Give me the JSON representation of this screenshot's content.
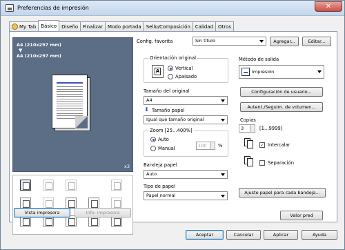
{
  "window": {
    "title": "Preferencias de impresión",
    "close_glyph": "✕"
  },
  "tabs": [
    {
      "label": "My Tab",
      "icon": "user-icon"
    },
    {
      "label": "Básico",
      "active": true
    },
    {
      "label": "Diseño"
    },
    {
      "label": "Finalizar"
    },
    {
      "label": "Modo portada"
    },
    {
      "label": "Sello/Composición"
    },
    {
      "label": "Calidad"
    },
    {
      "label": "Otros"
    }
  ],
  "preview": {
    "paper_top": "A4 (210x297 mm)",
    "arrow": "▼",
    "paper_bottom": "A4 (210x297 mm)",
    "copies_badge": "x3"
  },
  "left_buttons": {
    "printer_view": "Vista impresora",
    "printer_info": "Info. impresora"
  },
  "favorites": {
    "label": "Config. favorita",
    "value": "Sin título",
    "add": "Agregar...",
    "edit": "Editar..."
  },
  "orientation": {
    "group_title": "Orientación original",
    "vertical": "Vertical",
    "landscape": "Apaisado",
    "selected": "Vertical"
  },
  "original_size": {
    "label": "Tamaño del original",
    "value": "A4"
  },
  "paper_size": {
    "label": "Tamaño papel",
    "value": "Igual que tamaño original"
  },
  "zoom": {
    "group_title": "Zoom [25...400%]",
    "auto": "Auto",
    "manual": "Manual",
    "value": "100",
    "unit": "%",
    "selected": "Auto"
  },
  "tray": {
    "label": "Bandeja papel",
    "value": "Auto"
  },
  "paper_type": {
    "label": "Tipo de papel",
    "value": "Papel normal"
  },
  "output": {
    "label": "Método de salida",
    "value": "Impresión",
    "user_settings": "Configuración de usuario...",
    "auth_volume": "Autent./Seguim. de volumen..."
  },
  "copies": {
    "label": "Copias",
    "value": "3",
    "range": "[1...9999]",
    "collate": "Intercalar",
    "collate_checked": true,
    "offset": "Separación",
    "offset_checked": false
  },
  "adjust_paper": "Ajuste papel para cada bandeja...",
  "default_value": "Valor pred",
  "footer": {
    "accept": "Aceptar",
    "cancel": "Cancelar",
    "apply": "Aplicar",
    "help": "Ayuda"
  }
}
